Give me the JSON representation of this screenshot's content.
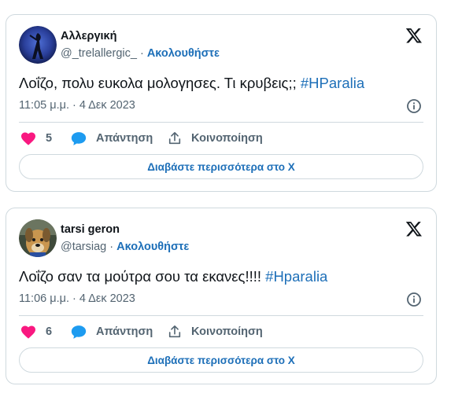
{
  "tweets": [
    {
      "name": "Αλλεργική",
      "handle": "@_trelallergic_",
      "separator": " · ",
      "follow_label": "Ακολουθήστε",
      "text": "Λοΐζο, πολυ ευκολα μολογησες. Τι κρυβεις;; ",
      "hashtag": "#HParalia",
      "timestamp": "11:05 μ.μ. · 4 Δεκ 2023",
      "like_count": "5",
      "reply_label": "Απάντηση",
      "share_label": "Κοινοποίηση",
      "read_more_label": "Διαβάστε περισσότερα στο X"
    },
    {
      "name": "tarsi geron",
      "handle": "@tarsiag",
      "separator": " · ",
      "follow_label": "Ακολουθήστε",
      "text": "Λοΐζο σαν τα μούτρα σου τα εκανες!!!! ",
      "hashtag": "#Hparalia",
      "timestamp": "11:06 μ.μ. · 4 Δεκ 2023",
      "like_count": "6",
      "reply_label": "Απάντηση",
      "share_label": "Κοινοποίηση",
      "read_more_label": "Διαβάστε περισσότερα στο X"
    }
  ],
  "colors": {
    "link": "#1d6fb8",
    "heart": "#f91880",
    "reply_bubble": "#1d9bf0",
    "border": "#cfd9de",
    "secondary_text": "#536471"
  },
  "icons": [
    "x-logo-icon",
    "info-icon",
    "heart-icon",
    "reply-bubble-icon",
    "share-icon"
  ]
}
